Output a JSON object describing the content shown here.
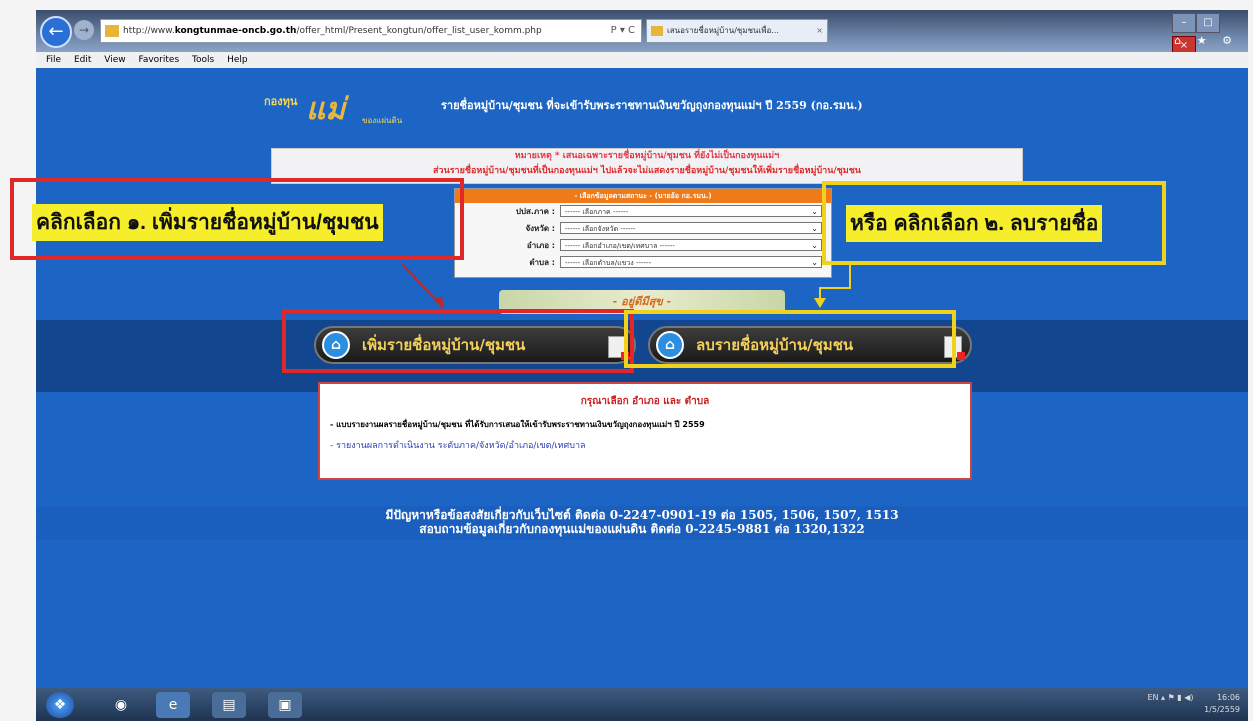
{
  "browser": {
    "url_prefix": "http://www.",
    "url_domain": "kongtunmae-oncb.go.th",
    "url_path": "/offer_html/Present_kongtun/offer_list_user_komm.php",
    "addr_buttons": "P ▾ C",
    "tab_title": "เสนอรายชื่อหมู่บ้าน/ชุมชนเพื่อ...",
    "tab_close": "×",
    "menu": [
      "File",
      "Edit",
      "View",
      "Favorites",
      "Tools",
      "Help"
    ],
    "toolbar_icons": "⌂ ★ ⚙"
  },
  "header": {
    "logo_top": "กองทุน",
    "logo_main": "แม่",
    "logo_sub": "ของแผ่นดิน",
    "title": "รายชื่อหมู่บ้าน/ชุมชน ที่จะเข้ารับพระราชทานเงินขวัญถุงกองทุนแม่ฯ ปี 2559 (กอ.รมน.)"
  },
  "notice": {
    "line1": "หมายเหตุ * เสนอเฉพาะรายชื่อหมู่บ้าน/ชุมชน ที่ยังไม่เป็นกองทุนแม่ฯ",
    "line2": "ส่วนรายชื่อหมู่บ้าน/ชุมชนที่เป็นกองทุนแม่ฯ ไปแล้วจะไม่แสดงรายชื่อหมู่บ้าน/ชุมชนให้เพิ่มรายชื่อหมู่บ้าน/ชุมชน"
  },
  "selector": {
    "heading": "- เลือกข้อมูลตามสถานะ - (นายอ้อ กอ.รมน.)",
    "rows": [
      {
        "label": "ปปส.ภาค :",
        "value": "------ เลือกภาค ------"
      },
      {
        "label": "จังหวัด :",
        "value": "------ เลือกจังหวัด ------"
      },
      {
        "label": "อำเภอ :",
        "value": "------ เลือกอำเภอ/เขต/เทศบาล ------"
      },
      {
        "label": "ตำบล :",
        "value": "------ เลือกตำบล/แขวง ------"
      }
    ]
  },
  "banner_text": "- อยู่ดีมีสุข -",
  "buttons": {
    "add": "เพิ่มรายชื่อหมู่บ้าน/ชุมชน",
    "remove": "ลบรายชื่อหมู่บ้าน/ชุมชน"
  },
  "info": {
    "title": "กรุณาเลือก อำเภอ และ ตำบล",
    "line1": "- แบบรายงานผลรายชื่อหมู่บ้าน/ชุมชน ที่ได้รับการเสนอให้เข้ารับพระราชทานเงินขวัญถุงกองทุนแม่ฯ ปี 2559",
    "line2": "- รายงานผลการดำเนินงาน ระดับภาค/จังหวัด/อำเภอ/เขต/เทศบาล"
  },
  "footer": {
    "line1": "มีปัญหาหรือข้อสงสัยเกี่ยวกับเว็บไซต์ ติดต่อ 0-2247-0901-19 ต่อ 1505, 1506, 1507, 1513",
    "line2": "สอบถามข้อมูลเกี่ยวกับกองทุนแม่ของแผ่นดิน ติดต่อ 0-2245-9881 ต่อ 1320,1322"
  },
  "annotations": {
    "left": "คลิกเลือก ๑. เพิ่มรายชื่อหมู่บ้าน/ชุมชน",
    "right": "หรือ คลิกเลือก ๒. ลบรายชื่อ"
  },
  "taskbar": {
    "clock_time": "16:06",
    "clock_date": "1/5/2559",
    "tray_lang": "EN"
  }
}
